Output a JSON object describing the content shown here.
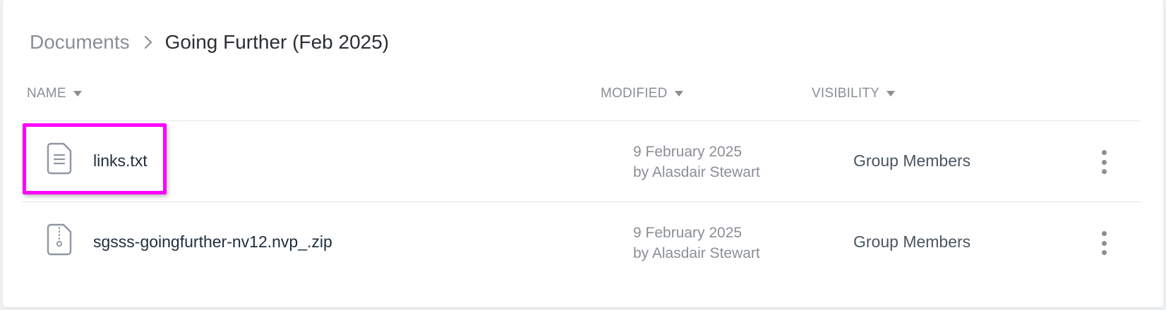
{
  "breadcrumb": {
    "root": "Documents",
    "current": "Going Further (Feb 2025)"
  },
  "columns": {
    "name": "NAME",
    "modified": "MODIFIED",
    "visibility": "VISIBILITY"
  },
  "files": [
    {
      "name": "links.txt",
      "icon": "text-file-icon",
      "modified_date": "9 February 2025",
      "modified_by": "by Alasdair Stewart",
      "visibility": "Group Members"
    },
    {
      "name": "sgsss-goingfurther-nv12.nvp_.zip",
      "icon": "zip-file-icon",
      "modified_date": "9 February 2025",
      "modified_by": "by Alasdair Stewart",
      "visibility": "Group Members"
    }
  ],
  "colors": {
    "highlight": "#ff00ff",
    "muted_text": "#8a8f95",
    "primary_text": "#1f2d3d"
  }
}
